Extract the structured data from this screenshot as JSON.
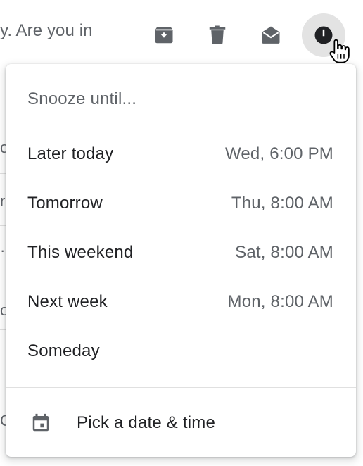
{
  "background": {
    "row_preview_text": "y. Are you in",
    "edge_fragments": [
      "o",
      "r",
      "·",
      "o",
      "C"
    ]
  },
  "toolbar": {
    "buttons": [
      {
        "name": "archive-button",
        "icon": "archive-icon"
      },
      {
        "name": "delete-button",
        "icon": "trash-icon"
      },
      {
        "name": "mark-read-button",
        "icon": "mail-open-icon"
      },
      {
        "name": "snooze-button",
        "icon": "clock-icon",
        "active": true
      }
    ]
  },
  "snooze_menu": {
    "heading": "Snooze until...",
    "options": [
      {
        "label": "Later today",
        "time": "Wed, 6:00 PM"
      },
      {
        "label": "Tomorrow",
        "time": "Thu, 8:00 AM"
      },
      {
        "label": "This weekend",
        "time": "Sat, 8:00 AM"
      },
      {
        "label": "Next week",
        "time": "Mon, 8:00 AM"
      },
      {
        "label": "Someday",
        "time": ""
      }
    ],
    "pick_label": "Pick a date & time",
    "pick_icon": "calendar-icon"
  },
  "colors": {
    "text_primary": "#202124",
    "text_secondary": "#5f6368",
    "icon": "#5f6368",
    "active_bg": "#e3e3e3"
  }
}
